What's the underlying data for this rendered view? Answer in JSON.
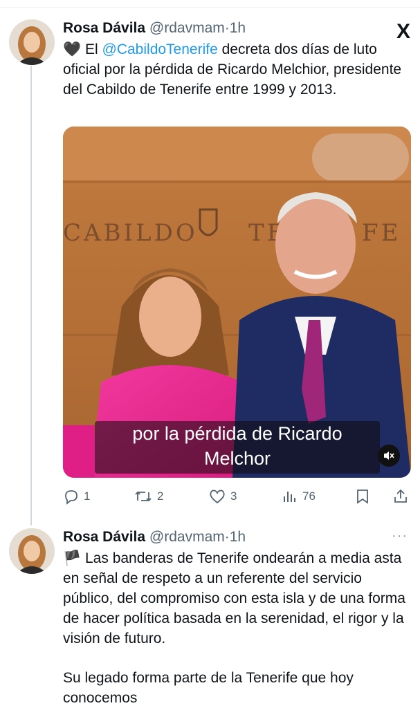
{
  "tweets": [
    {
      "name": "Rosa Dávila",
      "handle": "@rdavmam",
      "dot": "·",
      "time": "1h",
      "emoji": "🖤",
      "text_before": "El ",
      "mention": "@CabildoTenerife",
      "text_after": " decreta dos días de luto oficial por la pérdida de Ricardo Melchior, presidente del Cabildo de Tenerife entre 1999 y 2013.",
      "media": {
        "sign_left": "CABILDO",
        "sign_right": "TE",
        "sign_end": "FE",
        "caption_line1": "por la pérdida de Ricardo",
        "caption_line2": "Melchor"
      },
      "actions": {
        "replies": "1",
        "reposts": "2",
        "likes": "3",
        "views": "76"
      }
    },
    {
      "name": "Rosa Dávila",
      "handle": "@rdavmam",
      "dot": "·",
      "time": "1h",
      "more": "···",
      "emoji": "🏴",
      "para1": "Las banderas de Tenerife ondearán a media asta en señal de respeto a un referente del servicio público, del compromiso con esta isla y de una forma de hacer política basada en la serenidad, el rigor y la visión de futuro.",
      "para2": "Su legado forma parte de la Tenerife que hoy conocemos"
    }
  ],
  "app": {
    "logo": "X"
  },
  "colors": {
    "accent": "#1d9bf0",
    "secondary_text": "#536471",
    "thread_line": "#cfd9de"
  },
  "icons": [
    "reply-icon",
    "repost-icon",
    "like-icon",
    "views-icon",
    "bookmark-icon",
    "share-icon",
    "mute-icon",
    "x-logo-icon",
    "more-icon"
  ]
}
